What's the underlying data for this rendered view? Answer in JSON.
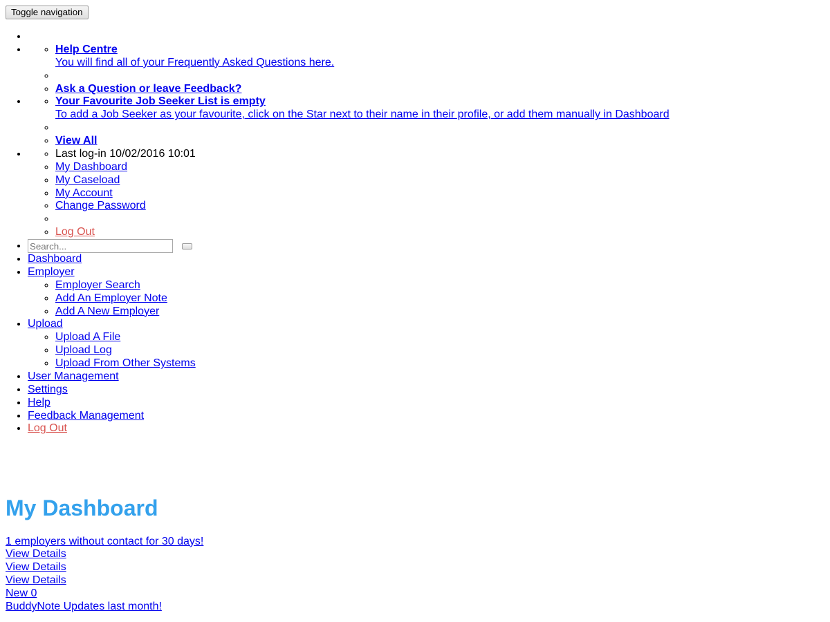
{
  "toggle": {
    "label": "Toggle navigation"
  },
  "search": {
    "placeholder": "Search...",
    "value": "",
    "submit_label": "",
    "icon": "search-icon"
  },
  "help_menu": {
    "help_centre_title": "Help Centre",
    "help_centre_desc": "You will find all of your Frequently Asked Questions here.",
    "ask_question_title": "Ask a Question or leave Feedback?"
  },
  "favourites_menu": {
    "empty_title": "Your Favourite Job Seeker List is empty",
    "empty_desc": "To add a Job Seeker as your favourite, click on the Star next to their name in their profile, or add them manually in Dashboard",
    "view_all": "View All"
  },
  "account_menu": {
    "last_login": "Last log-in 10/02/2016 10:01",
    "items": [
      {
        "label": "My Dashboard"
      },
      {
        "label": "My Caseload"
      },
      {
        "label": "My Account"
      },
      {
        "label": "Change Password"
      }
    ],
    "log_out": "Log Out"
  },
  "nav": {
    "items": [
      {
        "label": "Dashboard",
        "children": []
      },
      {
        "label": "Employer",
        "children": [
          {
            "label": "Employer Search"
          },
          {
            "label": "Add An Employer Note"
          },
          {
            "label": "Add A New Employer"
          }
        ]
      },
      {
        "label": "Upload",
        "children": [
          {
            "label": "Upload A File"
          },
          {
            "label": "Upload Log"
          },
          {
            "label": "Upload From Other Systems"
          }
        ]
      },
      {
        "label": "User Management",
        "children": []
      },
      {
        "label": "Settings",
        "children": []
      },
      {
        "label": "Help",
        "children": []
      },
      {
        "label": "Feedback Management",
        "children": []
      }
    ],
    "log_out": "Log Out"
  },
  "main": {
    "title": "My Dashboard",
    "alerts": [
      {
        "label": "1 employers without contact for 30 days!"
      },
      {
        "label": "View Details"
      },
      {
        "label": "View Details"
      },
      {
        "label": "View Details"
      },
      {
        "label": "New 0"
      },
      {
        "label": "BuddyNote Updates last month!"
      }
    ]
  },
  "colors": {
    "link": "#0000ee",
    "danger": "#d9534f",
    "title": "#33a1ec"
  }
}
